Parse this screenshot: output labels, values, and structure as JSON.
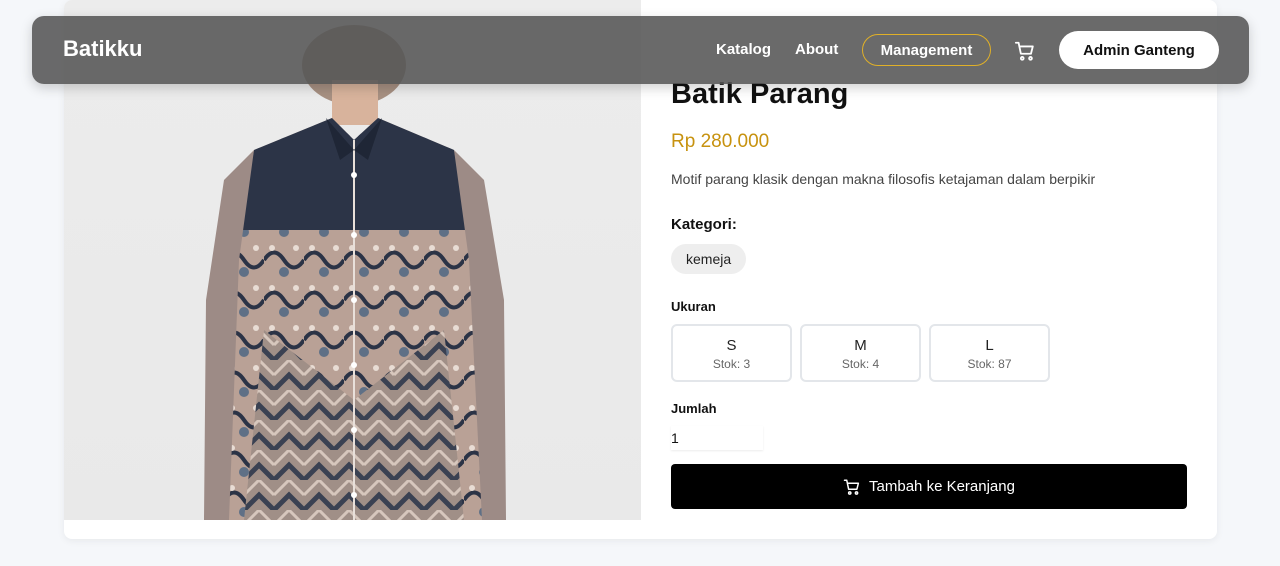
{
  "navbar": {
    "brand": "Batikku",
    "links": [
      "Katalog",
      "About"
    ],
    "management_label": "Management",
    "cart_icon": "cart-icon",
    "user_label": "Admin Ganteng",
    "accent_color": "#e0b028"
  },
  "product": {
    "image_icon": "batik-shirt-photo",
    "name": "Batik Parang",
    "price": "Rp 280.000",
    "description": "Motif parang klasik dengan makna filosofis ketajaman dalam berpikir",
    "category_label": "Kategori:",
    "category": "kemeja",
    "size_label": "Ukuran",
    "sizes": [
      {
        "size": "S",
        "stock": "Stok: 3"
      },
      {
        "size": "M",
        "stock": "Stok: 4"
      },
      {
        "size": "L",
        "stock": "Stok: 87"
      }
    ],
    "quantity_label": "Jumlah",
    "quantity_value": "1",
    "add_to_cart_label": "Tambah ke Keranjang",
    "price_color": "#c7920f"
  }
}
